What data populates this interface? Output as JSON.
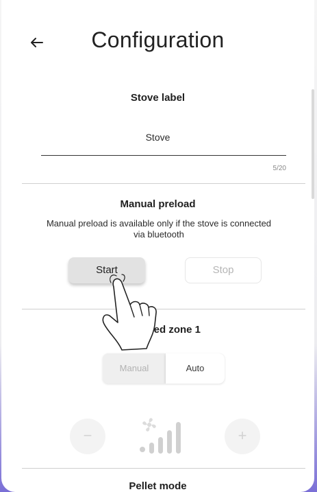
{
  "header": {
    "title": "Configuration",
    "back_icon": "arrow-left-icon"
  },
  "stove_label": {
    "title": "Stove label",
    "value": "Stove",
    "counter": "5/20"
  },
  "manual_preload": {
    "title": "Manual preload",
    "description": "Manual preload is available only if the stove is connected via bluetooth",
    "start_label": "Start",
    "stop_label": "Stop"
  },
  "fan_speed_zone": {
    "title": "Fan speed zone 1",
    "mode_manual": "Manual",
    "mode_auto": "Auto",
    "selected_mode": "Auto",
    "minus_label": "−",
    "plus_label": "+"
  },
  "pellet_mode": {
    "title": "Pellet mode"
  },
  "colors": {
    "text": "#1f1f1f",
    "disabled": "#b5b5b5",
    "divider": "#cfcfcf",
    "accent_edge": "#7a6fd6"
  }
}
